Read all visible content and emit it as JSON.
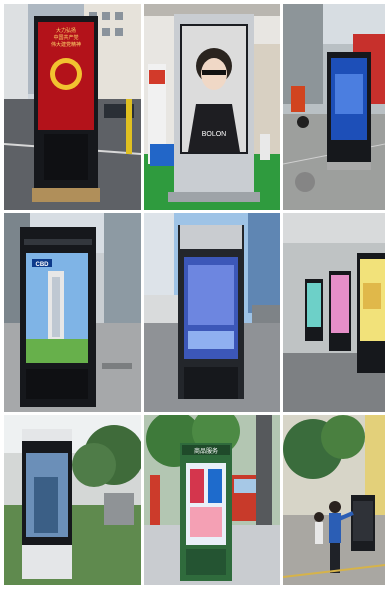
{
  "gallery": {
    "tiles": [
      {
        "screen_text": [
          "大力弘扬",
          "中国共产党",
          "伟大建党精神"
        ]
      },
      {
        "screen_text": [
          "BOLON"
        ]
      },
      {
        "screen_text": []
      },
      {
        "screen_text": [
          "CBD"
        ]
      },
      {
        "screen_text": []
      },
      {
        "screen_text": []
      },
      {
        "screen_text": []
      },
      {
        "screen_text": [
          "商品服务"
        ]
      },
      {
        "screen_text": []
      }
    ]
  },
  "colors": {
    "sky": "#9ec3e6",
    "kiosk_black": "#16181c",
    "kiosk_silver": "#c9cdd2",
    "party_red": "#b3121a",
    "grass": "#2f9b3e"
  }
}
